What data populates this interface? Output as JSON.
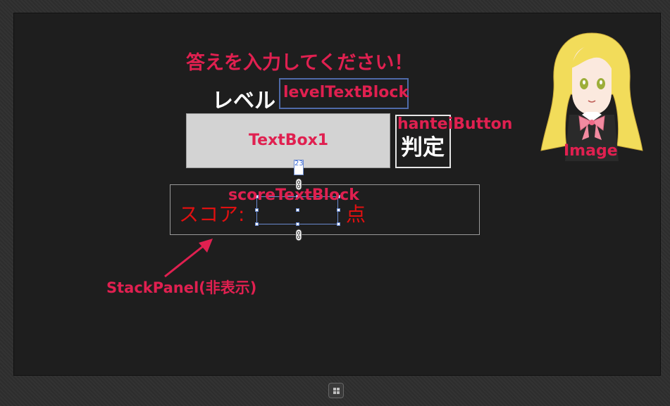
{
  "prompt": "答えを入力してください！",
  "level": {
    "label": "レベル",
    "annotation": "levelTextBlock"
  },
  "textbox": {
    "annotation": "TextBox1"
  },
  "hantei": {
    "label": "判定",
    "annotation": "hanteiButton"
  },
  "image": {
    "annotation": "Image"
  },
  "score": {
    "label": "スコア:",
    "annotation": "scoreTextBlock",
    "unit": "点",
    "dimension": "23"
  },
  "stack_panel": {
    "annotation": "StackPanel(非表示)"
  },
  "colors": {
    "annotation": "#e02050",
    "score_text": "#e01010",
    "selection": "#6a8ad0",
    "level_border": "#4f6aa8",
    "screen_bg": "#1e1e1e"
  },
  "icons": {
    "taskbar": "windows-logo-icon",
    "arrow": "arrow-icon",
    "character": "anime-girl-illustration"
  }
}
